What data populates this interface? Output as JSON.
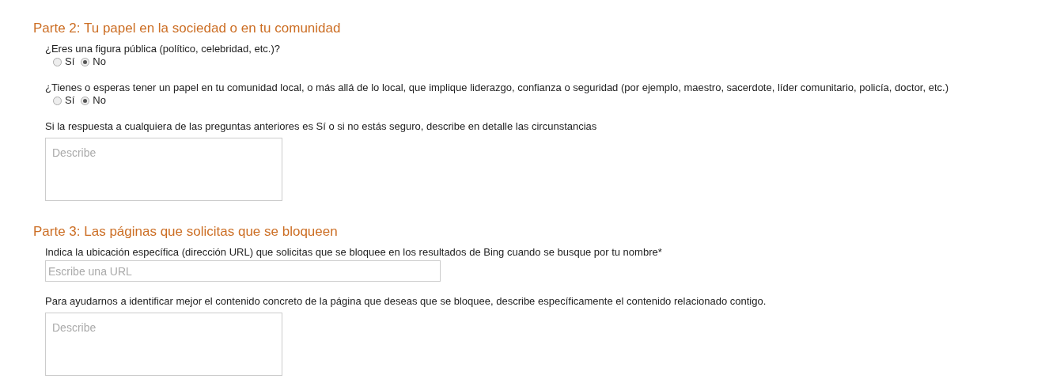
{
  "sections": [
    {
      "title": "Parte 2: Tu papel en la sociedad o en tu comunidad",
      "fields": [
        {
          "kind": "radio",
          "label": "¿Eres una figura pública (político, celebridad, etc.)?",
          "options": [
            {
              "label": "Sí",
              "selected": false
            },
            {
              "label": "No",
              "selected": true
            }
          ]
        },
        {
          "kind": "radio",
          "label": "¿Tienes o esperas tener un papel en tu comunidad local, o más allá de lo local, que implique liderazgo, confianza o seguridad (por ejemplo, maestro, sacerdote, líder comunitario, policía, doctor, etc.)",
          "options": [
            {
              "label": "Sí",
              "selected": false
            },
            {
              "label": "No",
              "selected": true
            }
          ]
        },
        {
          "kind": "textarea",
          "label": "Si la respuesta a cualquiera de las preguntas anteriores es Sí o si no estás seguro, describe en detalle las circunstancias",
          "placeholder": "Describe"
        }
      ]
    },
    {
      "title": "Parte 3: Las páginas que solicitas que se bloqueen",
      "fields": [
        {
          "kind": "input",
          "label": "Indica la ubicación específica (dirección URL) que solicitas que se bloquee en los resultados de Bing cuando se busque por tu nombre*",
          "placeholder": "Escribe una URL"
        },
        {
          "kind": "textarea",
          "label": "Para ayudarnos a identificar mejor el contenido concreto de la página que deseas que se bloquee, describe específicamente el contenido relacionado contigo.",
          "placeholder": "Describe"
        }
      ]
    }
  ]
}
